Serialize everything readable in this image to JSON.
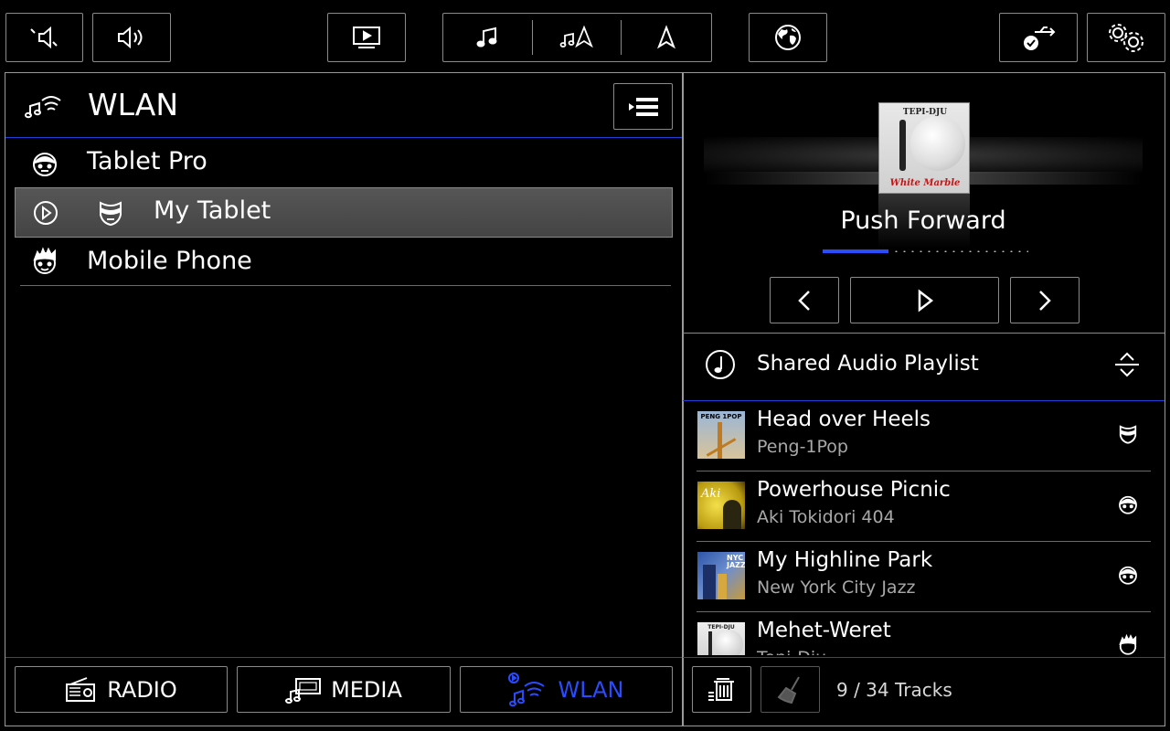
{
  "top_bar": {
    "buttons": [
      {
        "icon": "volume-down-icon"
      },
      {
        "icon": "volume-up-icon"
      },
      {
        "icon": "video-screen-icon"
      },
      {
        "icon": "music-note-icon"
      },
      {
        "icon": "music-navigation-icon"
      },
      {
        "icon": "navigation-arrow-icon"
      },
      {
        "icon": "globe-icon"
      },
      {
        "icon": "usb-check-icon"
      },
      {
        "icon": "gear-icon"
      }
    ]
  },
  "source_header": {
    "title": "WLAN",
    "icon": "wlan-music-icon",
    "menu_icon": "list-menu-icon"
  },
  "devices": [
    {
      "name": "Tablet Pro",
      "icon": "face-icon",
      "selected": false
    },
    {
      "name": "My Tablet",
      "icon": "mask-face-icon",
      "selected": true
    },
    {
      "name": "Mobile Phone",
      "icon": "spiky-face-icon",
      "selected": false
    }
  ],
  "now_playing": {
    "album_cover": {
      "artist_text": "TEPI-DJU",
      "album_text": "White Marble"
    },
    "title": "Push Forward",
    "progress": 0.32
  },
  "playlist": {
    "title": "Shared Audio Playlist",
    "tracks": [
      {
        "title": "Head over Heels",
        "artist": "Peng-1Pop",
        "cover_text": "PENG 1POP"
      },
      {
        "title": "Powerhouse Picnic",
        "artist": "Aki Tokidori 404",
        "cover_text": "Aki"
      },
      {
        "title": "My Highline Park",
        "artist": "New York City Jazz",
        "cover_text": "NYC JAZZ"
      },
      {
        "title": "Mehet-Weret",
        "artist": "Tepi-Dju",
        "cover_text": "TEPI-DJU"
      }
    ],
    "track_count": "9 / 34 Tracks"
  },
  "bottom_tabs": {
    "radio": "RADIO",
    "media": "MEDIA",
    "wlan": "WLAN"
  },
  "colors": {
    "accent_blue": "#1f3fd6",
    "border": "#8a8a8a",
    "selected_row": "#4a4a4a",
    "secondary_text": "#a8a8a8"
  }
}
